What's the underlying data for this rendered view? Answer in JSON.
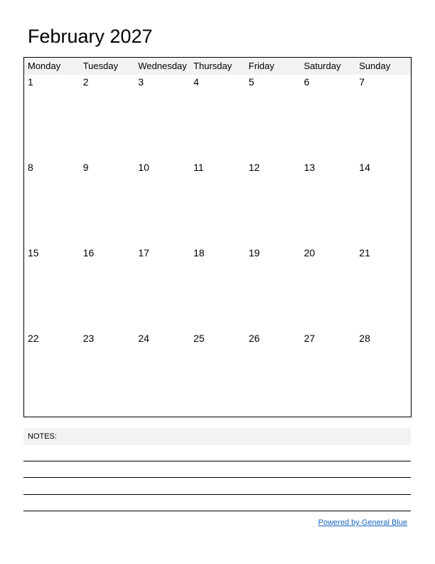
{
  "title": "February 2027",
  "weekdays": [
    "Monday",
    "Tuesday",
    "Wednesday",
    "Thursday",
    "Friday",
    "Saturday",
    "Sunday"
  ],
  "weeks": [
    [
      "1",
      "2",
      "3",
      "4",
      "5",
      "6",
      "7"
    ],
    [
      "8",
      "9",
      "10",
      "11",
      "12",
      "13",
      "14"
    ],
    [
      "15",
      "16",
      "17",
      "18",
      "19",
      "20",
      "21"
    ],
    [
      "22",
      "23",
      "24",
      "25",
      "26",
      "27",
      "28"
    ]
  ],
  "notes": {
    "label": "NOTES:"
  },
  "footer": {
    "powered_by": "Powered by General Blue",
    "link_color": "#1565c0"
  }
}
